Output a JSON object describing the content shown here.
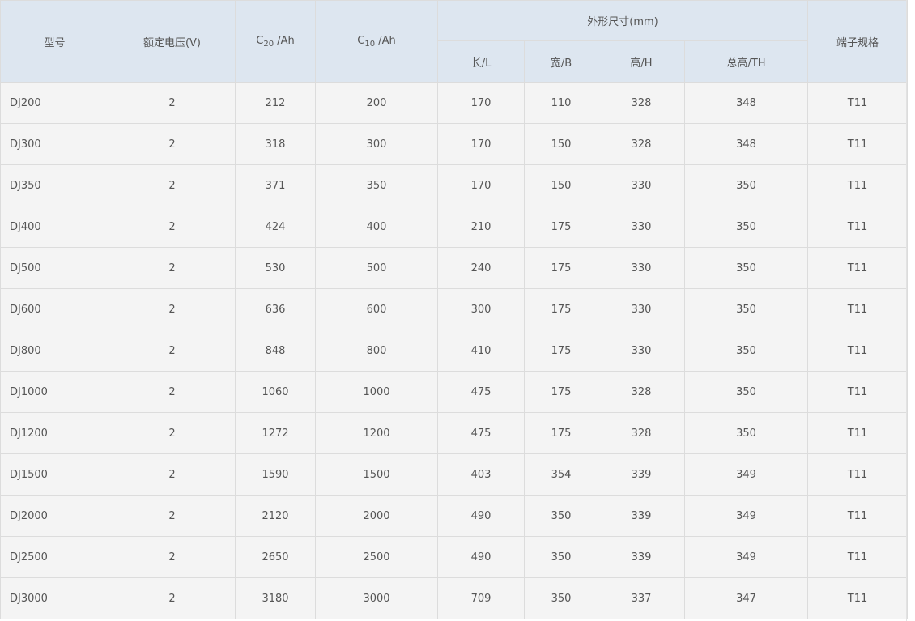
{
  "header": {
    "model": "型号",
    "voltage": "额定电压(V)",
    "c20_main": "C",
    "c20_sub": "20",
    "c20_unit": " /Ah",
    "c10_main": "C",
    "c10_sub": "10",
    "c10_unit": " /Ah",
    "dimensions": "外形尺寸(mm)",
    "length": "长/L",
    "width": "宽/B",
    "height": "高/H",
    "total_height": "总高/TH",
    "terminal": "端子规格"
  },
  "rows": [
    [
      "DJ200",
      "2",
      "212",
      "200",
      "170",
      "110",
      "328",
      "348",
      "T11"
    ],
    [
      "DJ300",
      "2",
      "318",
      "300",
      "170",
      "150",
      "328",
      "348",
      "T11"
    ],
    [
      "DJ350",
      "2",
      "371",
      "350",
      "170",
      "150",
      "330",
      "350",
      "T11"
    ],
    [
      "DJ400",
      "2",
      "424",
      "400",
      "210",
      "175",
      "330",
      "350",
      "T11"
    ],
    [
      "DJ500",
      "2",
      "530",
      "500",
      "240",
      "175",
      "330",
      "350",
      "T11"
    ],
    [
      "DJ600",
      "2",
      "636",
      "600",
      "300",
      "175",
      "330",
      "350",
      "T11"
    ],
    [
      "DJ800",
      "2",
      "848",
      "800",
      "410",
      "175",
      "330",
      "350",
      "T11"
    ],
    [
      "DJ1000",
      "2",
      "1060",
      "1000",
      "475",
      "175",
      "328",
      "350",
      "T11"
    ],
    [
      "DJ1200",
      "2",
      "1272",
      "1200",
      "475",
      "175",
      "328",
      "350",
      "T11"
    ],
    [
      "DJ1500",
      "2",
      "1590",
      "1500",
      "403",
      "354",
      "339",
      "349",
      "T11"
    ],
    [
      "DJ2000",
      "2",
      "2120",
      "2000",
      "490",
      "350",
      "339",
      "349",
      "T11"
    ],
    [
      "DJ2500",
      "2",
      "2650",
      "2500",
      "490",
      "350",
      "339",
      "349",
      "T11"
    ],
    [
      "DJ3000",
      "2",
      "3180",
      "3000",
      "709",
      "350",
      "337",
      "347",
      "T11"
    ]
  ]
}
